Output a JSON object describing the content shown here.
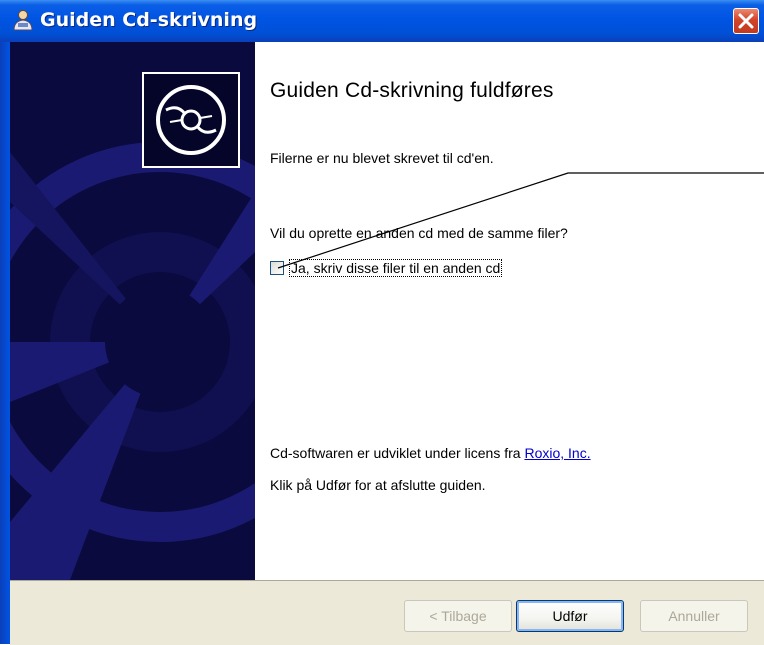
{
  "window": {
    "title": "Guiden Cd-skrivning"
  },
  "content": {
    "heading": "Guiden Cd-skrivning fuldføres",
    "written_text": "Filerne er nu blevet skrevet til cd'en.",
    "question": "Vil du oprette en anden cd med de samme filer?",
    "checkbox_label": "Ja, skriv disse filer til en anden cd",
    "checkbox_checked": false,
    "license_text": "Cd-softwaren er udviklet under licens fra",
    "license_link": "Roxio, Inc.",
    "finish_text": "Klik på Udfør for at afslutte guiden."
  },
  "buttons": {
    "back": "< Tilbage",
    "finish": "Udfør",
    "cancel": "Annuller"
  },
  "icons": {
    "title": "cd-writer-icon",
    "sidebar": "cd-disc-icon",
    "close": "close-icon"
  },
  "colors": {
    "titlebar": "#0054e3",
    "sidebar": "#0a0a3e",
    "footer": "#ece9d8",
    "link": "#0000cc",
    "close": "#d2452a"
  }
}
